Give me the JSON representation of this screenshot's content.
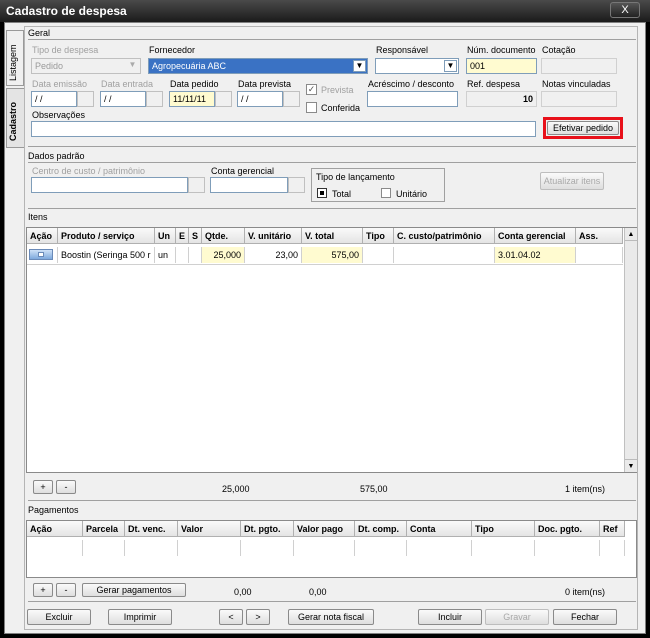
{
  "window": {
    "title": "Cadastro de despesa",
    "close_label": "X"
  },
  "tabs": [
    {
      "label": "Listagem"
    },
    {
      "label": "Cadastro"
    }
  ],
  "geral": {
    "section_label": "Geral",
    "tipo_despesa": {
      "label": "Tipo de despesa",
      "value": "Pedido"
    },
    "fornecedor": {
      "label": "Fornecedor",
      "value": "Agropecuária ABC"
    },
    "responsavel": {
      "label": "Responsável",
      "value": ""
    },
    "num_documento": {
      "label": "Núm. documento",
      "value": "001"
    },
    "cotacao": {
      "label": "Cotação",
      "value": ""
    },
    "data_emissao": {
      "label": "Data emissão",
      "value": " / /"
    },
    "data_entrada": {
      "label": "Data entrada",
      "value": " / /"
    },
    "data_pedido": {
      "label": "Data pedido",
      "value": "11/11/11"
    },
    "data_prevista": {
      "label": "Data prevista",
      "value": " / /"
    },
    "prevista": {
      "label": "Prevista",
      "checked": true
    },
    "conferida": {
      "label": "Conferida",
      "checked": false
    },
    "acrescimo": {
      "label": "Acréscimo / desconto",
      "value": ""
    },
    "ref_despesa": {
      "label": "Ref. despesa",
      "value": "10"
    },
    "notas_vinculadas": {
      "label": "Notas vinculadas",
      "value": ""
    },
    "observacoes": {
      "label": "Observações",
      "value": ""
    },
    "efetivar_label": "Efetivar pedido",
    "highlight_color": "#e8101a"
  },
  "dados_padrao": {
    "section_label": "Dados padrão",
    "centro_custo": {
      "label": "Centro de custo / patrimônio",
      "value": ""
    },
    "conta_gerencial": {
      "label": "Conta gerencial",
      "value": ""
    },
    "tipo_lancamento": {
      "label": "Tipo de lançamento",
      "total_label": "Total",
      "unitario_label": "Unitário",
      "selected": "Total"
    },
    "atualizar_label": "Atualizar itens"
  },
  "itens": {
    "section_label": "Itens",
    "headers": [
      "Ação",
      "Produto / serviço",
      "Un",
      "E",
      "S",
      "Qtde.",
      "V. unitário",
      "V. total",
      "Tipo",
      "C. custo/patrimônio",
      "Conta gerencial",
      "Ass."
    ],
    "rows": [
      {
        "acao": "",
        "produto": "Boostin (Seringa 500 r",
        "un": "un",
        "e": "",
        "s": "",
        "qtde": "25,000",
        "v_unitario": "23,00",
        "v_total": "575,00",
        "tipo": "",
        "ccusto": "",
        "conta": "3.01.04.02",
        "ass": ""
      }
    ],
    "add_label": "+",
    "remove_label": "-",
    "total_qtde": "25,000",
    "total_valor": "575,00",
    "count_label": "1 item(ns)"
  },
  "pagamentos": {
    "section_label": "Pagamentos",
    "headers": [
      "Ação",
      "Parcela",
      "Dt. venc.",
      "Valor",
      "Dt. pgto.",
      "Valor pago",
      "Dt. comp.",
      "Conta",
      "Tipo",
      "Doc. pgto.",
      "Ref"
    ],
    "add_label": "+",
    "remove_label": "-",
    "gerar_label": "Gerar pagamentos",
    "total_valor": "0,00",
    "total_pago": "0,00",
    "count_label": "0 item(ns)"
  },
  "footer": {
    "excluir": "Excluir",
    "imprimir": "Imprimir",
    "prev": "<",
    "next": ">",
    "gerar_nota": "Gerar nota fiscal",
    "incluir": "Incluir",
    "gravar": "Gravar",
    "fechar": "Fechar"
  }
}
